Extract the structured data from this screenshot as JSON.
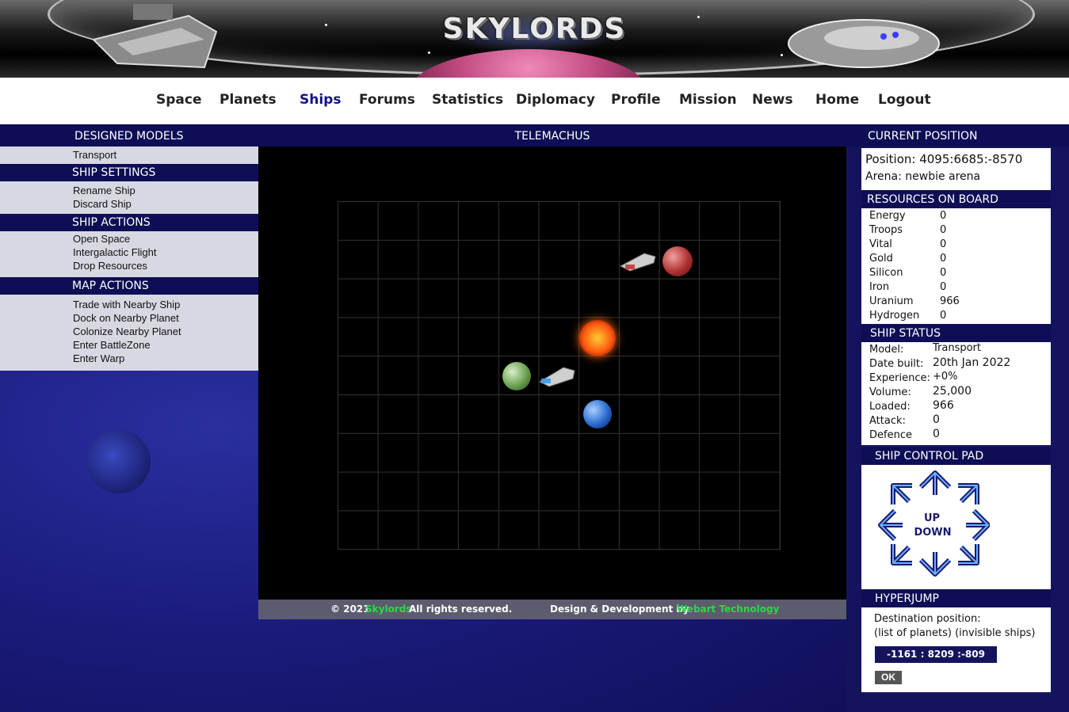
{
  "app": {
    "logo": "SKYLORDS"
  },
  "nav": {
    "items": [
      "Space",
      "Planets",
      "Ships",
      "Forums",
      "Statistics",
      "Diplomacy",
      "Profile",
      "Mission",
      "News",
      "Home",
      "Logout"
    ],
    "active": "Ships"
  },
  "left": {
    "designed_models_title": "DESIGNED MODELS",
    "designed_models": [
      "Transport"
    ],
    "ship_settings_title": "SHIP SETTINGS",
    "ship_settings": [
      "Rename Ship",
      "Discard Ship"
    ],
    "ship_actions_title": "SHIP ACTIONS",
    "ship_actions": [
      "Open Space",
      "Intergalactic Flight",
      "Drop Resources"
    ],
    "map_actions_title": "MAP ACTIONS",
    "map_actions": [
      "Trade with Nearby Ship",
      "Dock on Nearby Planet",
      "Colonize Nearby Planet",
      "Enter BattleZone",
      "Enter Warp"
    ]
  },
  "map": {
    "title": "TELEMACHUS"
  },
  "footer": {
    "copyright_prefix": "© 2021",
    "brand": "Skylords",
    "rights": "All rights reserved.",
    "design_prefix": "Design & Development by",
    "designer": "Webart Technology"
  },
  "position": {
    "title": "CURRENT POSITION",
    "position_text": "Position: 4095:6685:-8570",
    "arena_text": "Arena: newbie arena"
  },
  "resources": {
    "title": "RESOURCES ON BOARD",
    "rows": [
      {
        "name": "Energy",
        "value": "0"
      },
      {
        "name": "Troops",
        "value": "0"
      },
      {
        "name": "Vital",
        "value": "0"
      },
      {
        "name": "Gold",
        "value": "0"
      },
      {
        "name": "Silicon",
        "value": "0"
      },
      {
        "name": "Iron",
        "value": "0"
      },
      {
        "name": "Uranium",
        "value": "966"
      },
      {
        "name": "Hydrogen",
        "value": "0"
      }
    ]
  },
  "status": {
    "title": "SHIP STATUS",
    "rows": [
      {
        "name": "Model:",
        "value": "Transport"
      },
      {
        "name": "Date built:",
        "value": "20th Jan 2022"
      },
      {
        "name": "Experience:",
        "value": "+0%"
      },
      {
        "name": "Volume:",
        "value": "25,000"
      },
      {
        "name": "Loaded:",
        "value": "966"
      },
      {
        "name": "Attack:",
        "value": "0"
      },
      {
        "name": "Defence",
        "value": "0"
      }
    ]
  },
  "control_pad": {
    "title": "SHIP CONTROL PAD",
    "up": "UP",
    "down": "DOWN"
  },
  "hyperjump": {
    "title": "HYPERJUMP",
    "dest_label": "Destination position:",
    "links": "(list of planets) (invisible ships)",
    "dest_value": "-1161 : 8209 :-809",
    "ok": "OK"
  },
  "colors": {
    "accent": "#0e0e56",
    "link_green": "#22dd44",
    "menu_bg": "#d8d8e2"
  }
}
